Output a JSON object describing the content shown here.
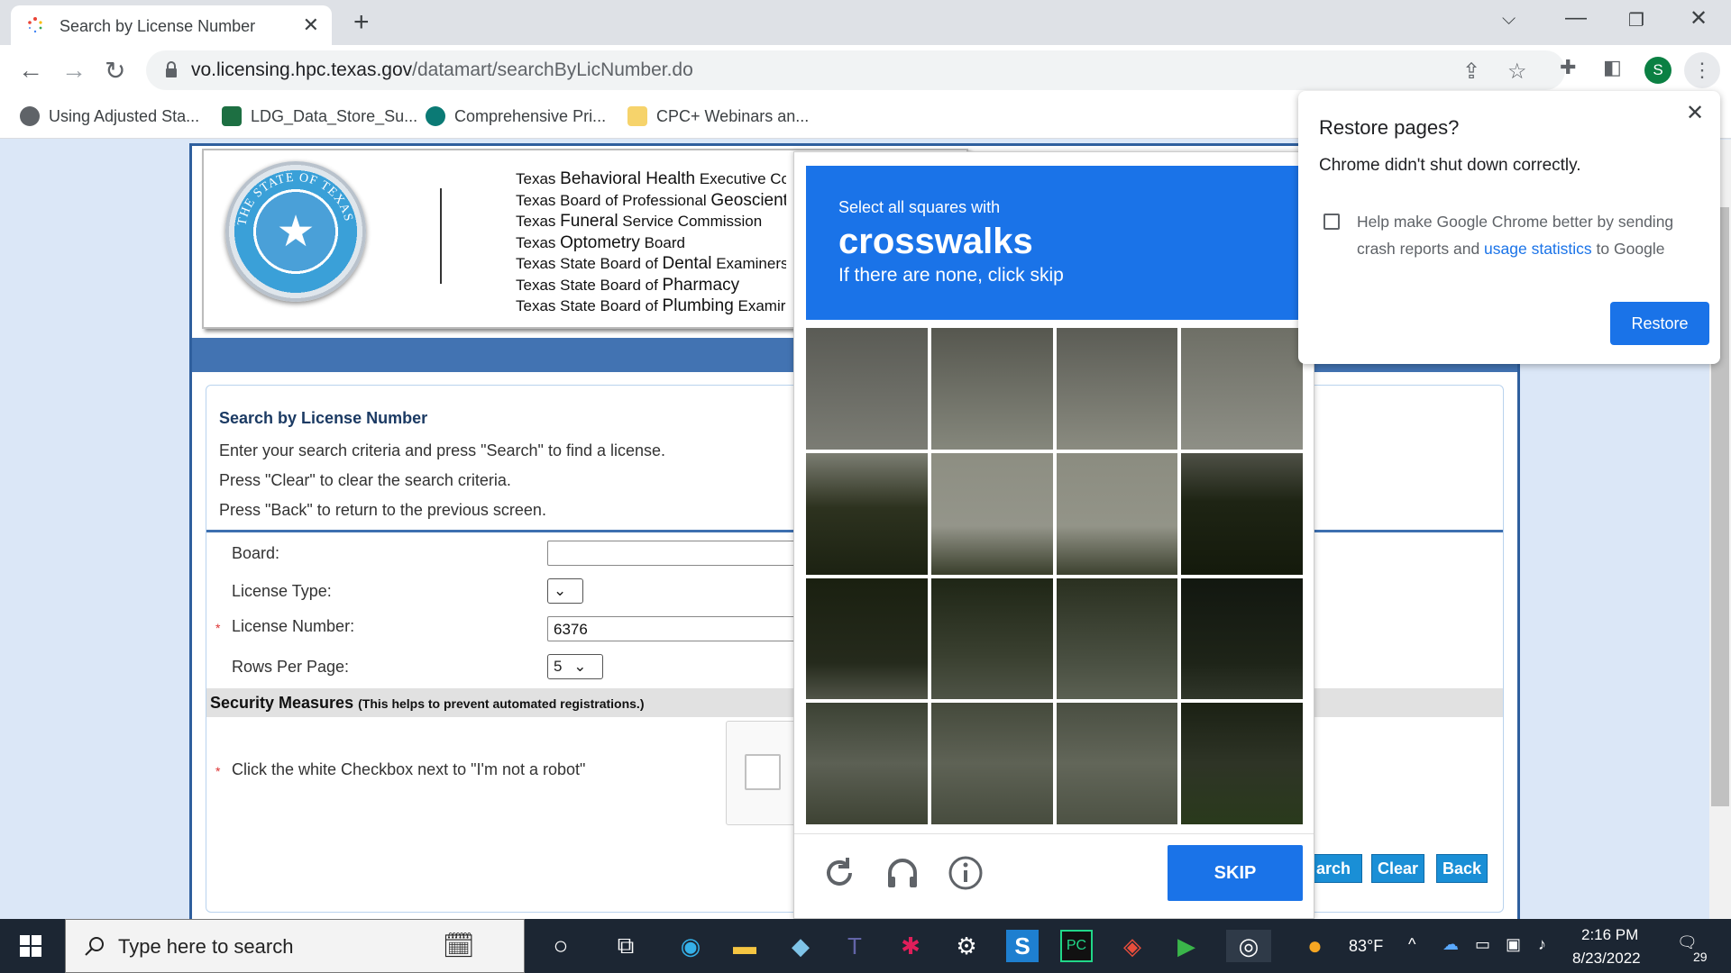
{
  "browser": {
    "tab_title": "Search by License Number",
    "new_tab_symbol": "+",
    "url_domain": "vo.licensing.hpc.texas.gov",
    "url_path": "/datamart/searchByLicNumber.do",
    "profile_initial": "S",
    "bookmarks": [
      {
        "label": "Using Adjusted Sta..."
      },
      {
        "label": "LDG_Data_Store_Su..."
      },
      {
        "label": "Comprehensive Pri..."
      },
      {
        "label": "CPC+ Webinars an..."
      }
    ]
  },
  "header": {
    "boards": [
      {
        "pre": "Texas ",
        "main": "Behavioral Health",
        "post": " Executive Co"
      },
      {
        "pre": "Texas Board of Professional ",
        "main": "Geoscient",
        "post": ""
      },
      {
        "pre": "Texas ",
        "main": "Funeral",
        "post": " Service Commission"
      },
      {
        "pre": "Texas ",
        "main": "Optometry",
        "post": " Board"
      },
      {
        "pre": "Texas State Board of ",
        "main": "Dental",
        "post": " Examiners"
      },
      {
        "pre": "Texas State Board of ",
        "main": "Pharmacy",
        "post": ""
      },
      {
        "pre": "Texas State Board of ",
        "main": "Plumbing",
        "post": " Examir"
      }
    ]
  },
  "form": {
    "title": "Search by License Number",
    "instructions": [
      "Enter your search criteria and press \"Search\" to find a license.",
      "Press \"Clear\" to clear the search criteria.",
      "Press \"Back\" to return to the previous screen."
    ],
    "board_label": "Board:",
    "board_value": "",
    "license_type_label": "License Type:",
    "license_number_label": "License Number:",
    "license_number_value": "6376",
    "rows_label": "Rows Per Page:",
    "rows_value": "5",
    "required_mark": "*",
    "security_title": "Security Measures",
    "security_note": "(This helps to prevent automated registrations.)",
    "robot_instruction": "Click the white Checkbox next to \"I'm not a robot\"",
    "search_btn": "arch",
    "clear_btn": "Clear",
    "back_btn": "Back"
  },
  "captcha": {
    "line1": "Select all squares with",
    "target": "crosswalks",
    "line3": "If there are none, click skip",
    "skip_label": "SKIP"
  },
  "restore_popup": {
    "title": "Restore pages?",
    "message": "Chrome didn't shut down correctly.",
    "help_text_a": "Help make Google Chrome better by sending crash reports and ",
    "help_link": "usage statistics",
    "help_text_b": " to Google",
    "button": "Restore"
  },
  "taskbar": {
    "search_placeholder": "Type here to search",
    "temperature": "83°F",
    "time": "2:16 PM",
    "date": "8/23/2022",
    "notifications": "29"
  }
}
